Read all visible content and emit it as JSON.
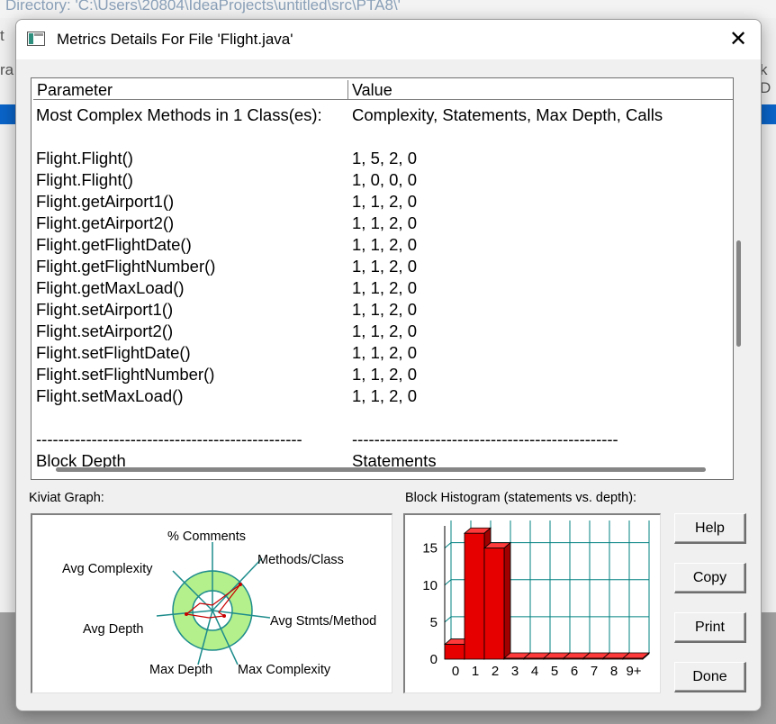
{
  "background": {
    "path_text": "Directory: 'C:\\Users\\20804\\IdeaProjects\\untitled\\src\\PTA8\\'",
    "left_fragment_1": "t",
    "left_fragment_2": "ra",
    "right_fragment": "k D"
  },
  "dialog": {
    "title": "Metrics Details For File 'Flight.java'",
    "close_glyph": "✕"
  },
  "table": {
    "headers": [
      "Parameter",
      "Value"
    ],
    "rows": [
      {
        "param": "Most Complex Methods in 1 Class(es):",
        "value": "Complexity, Statements, Max Depth, Calls"
      },
      {
        "param": "",
        "value": ""
      },
      {
        "param": "Flight.Flight()",
        "value": "1, 5, 2, 0"
      },
      {
        "param": "Flight.Flight()",
        "value": "1, 0, 0, 0"
      },
      {
        "param": "Flight.getAirport1()",
        "value": "1, 1, 2, 0"
      },
      {
        "param": "Flight.getAirport2()",
        "value": "1, 1, 2, 0"
      },
      {
        "param": "Flight.getFlightDate()",
        "value": "1, 1, 2, 0"
      },
      {
        "param": "Flight.getFlightNumber()",
        "value": "1, 1, 2, 0"
      },
      {
        "param": "Flight.getMaxLoad()",
        "value": "1, 1, 2, 0"
      },
      {
        "param": "Flight.setAirport1()",
        "value": "1, 1, 2, 0"
      },
      {
        "param": "Flight.setAirport2()",
        "value": "1, 1, 2, 0"
      },
      {
        "param": "Flight.setFlightDate()",
        "value": "1, 1, 2, 0"
      },
      {
        "param": "Flight.setFlightNumber()",
        "value": "1, 1, 2, 0"
      },
      {
        "param": "Flight.setMaxLoad()",
        "value": "1, 1, 2, 0"
      },
      {
        "param": "",
        "value": ""
      },
      {
        "param": "------------------------------------------------",
        "value": "------------------------------------------------"
      },
      {
        "param": "Block Depth",
        "value": "Statements"
      }
    ]
  },
  "kiviat": {
    "label": "Kiviat Graph:",
    "axes": {
      "comments": "% Comments",
      "methods_class": "Methods/Class",
      "avg_stmts": "Avg Stmts/Method",
      "max_complexity": "Max Complexity",
      "max_depth": "Max Depth",
      "avg_depth": "Avg Depth",
      "avg_complexity": "Avg Complexity"
    },
    "colors": {
      "ring": "#b4f08c",
      "outline": "#1e8c8c",
      "data": "#c80000"
    }
  },
  "histogram": {
    "label": "Block Histogram (statements vs. depth):"
  },
  "buttons": {
    "help": "Help",
    "copy": "Copy",
    "print": "Print",
    "done": "Done"
  },
  "chart_data": {
    "type": "bar",
    "title": "Block Histogram (statements vs. depth):",
    "categories": [
      "0",
      "1",
      "2",
      "3",
      "4",
      "5",
      "6",
      "7",
      "8",
      "9+"
    ],
    "values": [
      2,
      17,
      15,
      0,
      0,
      0,
      0,
      0,
      0,
      0
    ],
    "yticks": [
      0,
      5,
      10,
      15
    ],
    "ylim": [
      0,
      18
    ],
    "grid": true,
    "bar_color": "#e60000",
    "grid_color": "#008080"
  }
}
